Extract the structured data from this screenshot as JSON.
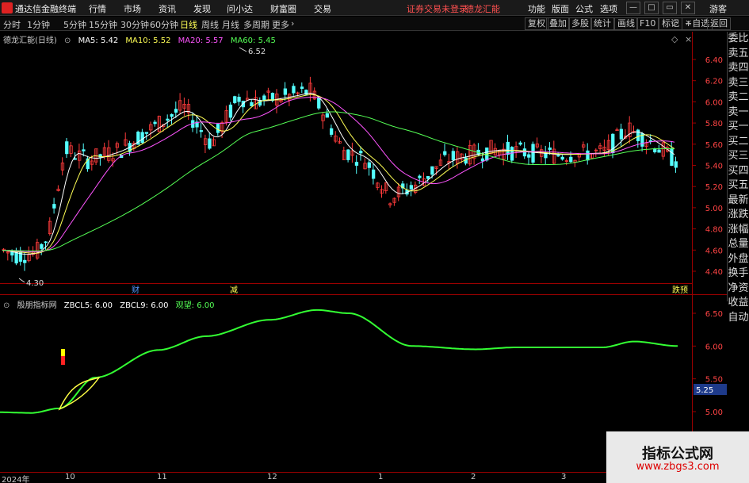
{
  "app": {
    "title": "通达信金融终端"
  },
  "menu": [
    "行情",
    "市场",
    "资讯",
    "发现",
    "问小达",
    "财富圈",
    "交易"
  ],
  "trade_warning": "证券交易未登录",
  "stock_name_header": "德龙汇能",
  "right_menu": [
    "功能",
    "版面",
    "公式",
    "选项"
  ],
  "guest": "游客",
  "periods": [
    "分时",
    "1分钟",
    "5分钟",
    "15分钟",
    "30分钟",
    "60分钟",
    "日线",
    "周线",
    "月线",
    "多周期",
    "更多"
  ],
  "active_period": "日线",
  "toolbar_right": [
    "复权",
    "叠加",
    "多股",
    "统计",
    "画线",
    "F10",
    "标记",
    "+自选",
    "返回"
  ],
  "main_chart": {
    "title": "德龙汇能(日线)",
    "ma": [
      {
        "label": "MA5: 5.42",
        "color": "#ffffff"
      },
      {
        "label": "MA10: 5.52",
        "color": "#ffff55"
      },
      {
        "label": "MA20: 5.57",
        "color": "#ff55ff"
      },
      {
        "label": "MA60: 5.45",
        "color": "#55ff55"
      }
    ],
    "y_ticks": [
      "6.40",
      "6.20",
      "6.00",
      "5.80",
      "5.60",
      "5.40",
      "5.20",
      "5.00",
      "4.80",
      "4.60",
      "4.40"
    ],
    "high_label": "6.52",
    "low_label": "4.30",
    "markers": [
      "财",
      "减",
      "跌预"
    ]
  },
  "indicator": {
    "title": "殷朋指标网",
    "values": [
      {
        "label": "ZBCL5: 6.00",
        "color": "#ffffff"
      },
      {
        "label": "ZBCL9: 6.00",
        "color": "#ffffff"
      },
      {
        "label": "观望: 6.00",
        "color": "#55ff55"
      }
    ],
    "y_ticks": [
      "6.50",
      "6.00",
      "5.50",
      "5.00"
    ],
    "current": "5.25"
  },
  "side_panel": [
    "委比",
    "卖五",
    "卖四",
    "卖三",
    "卖二",
    "卖一",
    "买一",
    "买二",
    "买三",
    "买四",
    "买五",
    "最新",
    "涨跌",
    "涨幅",
    "总量",
    "外盘",
    "换手",
    "净资",
    "收益",
    "自动"
  ],
  "x_axis": [
    "2024年",
    "10",
    "11",
    "12",
    "1",
    "2",
    "3"
  ],
  "watermark": {
    "title": "指标公式网",
    "url": "www.zbgs3.com"
  },
  "colors": {
    "up": "#ff3b3b",
    "down": "#54ffff",
    "grid": "#8b0000"
  }
}
